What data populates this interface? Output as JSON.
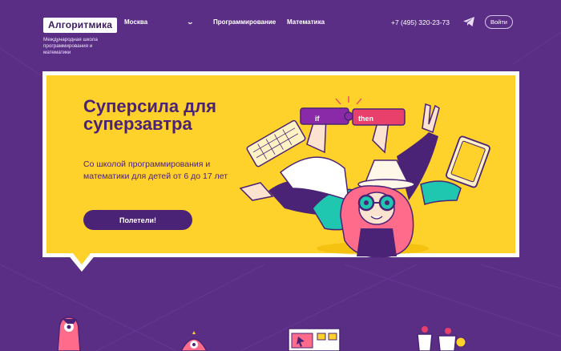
{
  "header": {
    "logo_text": "Алгоритмика",
    "tagline": "Международная школа программирования и математики",
    "city": "Москва",
    "nav": [
      {
        "label": "Программирование"
      },
      {
        "label": "Математика"
      }
    ],
    "phone": "+7 (495) 320-23-73",
    "login_label": "Войти"
  },
  "hero": {
    "title": "Суперсила для суперзавтра",
    "subtitle": "Со школой программирования и математики  для детей от 6 до 17 лет",
    "cta_label": "Полетели!",
    "puzzle_if": "if",
    "puzzle_then": "then"
  },
  "colors": {
    "background": "#5b2e86",
    "hero_yellow": "#ffd12b",
    "primary_purple": "#4b2376",
    "accent_pink": "#e8406a"
  },
  "icons": {
    "city_dropdown": "chevron-down-icon",
    "telegram": "telegram-icon"
  }
}
